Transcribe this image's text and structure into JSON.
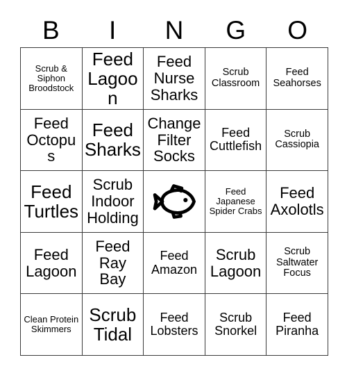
{
  "card": {
    "title": "BINGO",
    "header_letters": [
      "B",
      "I",
      "N",
      "G",
      "O"
    ],
    "grid_size": "5x5",
    "colors": {
      "border": "#3a3a3a",
      "cell_background": "#ffffff",
      "text": "#000000",
      "page_background": "#ffffff"
    },
    "free_space": {
      "row": 3,
      "column": 3,
      "icon": "fish-icon",
      "label": ""
    },
    "rows": [
      [
        {
          "label": "Scrub & Siphon Broodstock",
          "size": "xs"
        },
        {
          "label": "Feed Lagoon",
          "size": "xl"
        },
        {
          "label": "Feed Nurse Sharks",
          "size": "lg"
        },
        {
          "label": "Scrub Classroom",
          "size": "sm"
        },
        {
          "label": "Feed Seahorses",
          "size": "sm"
        }
      ],
      [
        {
          "label": "Feed Octopus",
          "size": "lg"
        },
        {
          "label": "Feed Sharks",
          "size": "xl"
        },
        {
          "label": "Change Filter Socks",
          "size": "lg"
        },
        {
          "label": "Feed Cuttlefish",
          "size": "md"
        },
        {
          "label": "Scrub Cassiopia",
          "size": "sm"
        }
      ],
      [
        {
          "label": "Feed Turtles",
          "size": "xl"
        },
        {
          "label": "Scrub Indoor Holding",
          "size": "lg"
        },
        {
          "label": "",
          "size": "free"
        },
        {
          "label": "Feed Japanese Spider Crabs",
          "size": "xs"
        },
        {
          "label": "Feed Axolotls",
          "size": "lg"
        }
      ],
      [
        {
          "label": "Feed Lagoon",
          "size": "lg"
        },
        {
          "label": "Feed Ray Bay",
          "size": "lg"
        },
        {
          "label": "Feed Amazon",
          "size": "md"
        },
        {
          "label": "Scrub Lagoon",
          "size": "lg"
        },
        {
          "label": "Scrub Saltwater Focus",
          "size": "sm"
        }
      ],
      [
        {
          "label": "Clean Protein Skimmers",
          "size": "xs"
        },
        {
          "label": "Scrub Tidal",
          "size": "xl"
        },
        {
          "label": "Feed Lobsters",
          "size": "md"
        },
        {
          "label": "Scrub Snorkel",
          "size": "md"
        },
        {
          "label": "Feed Piranha",
          "size": "md"
        }
      ]
    ]
  }
}
